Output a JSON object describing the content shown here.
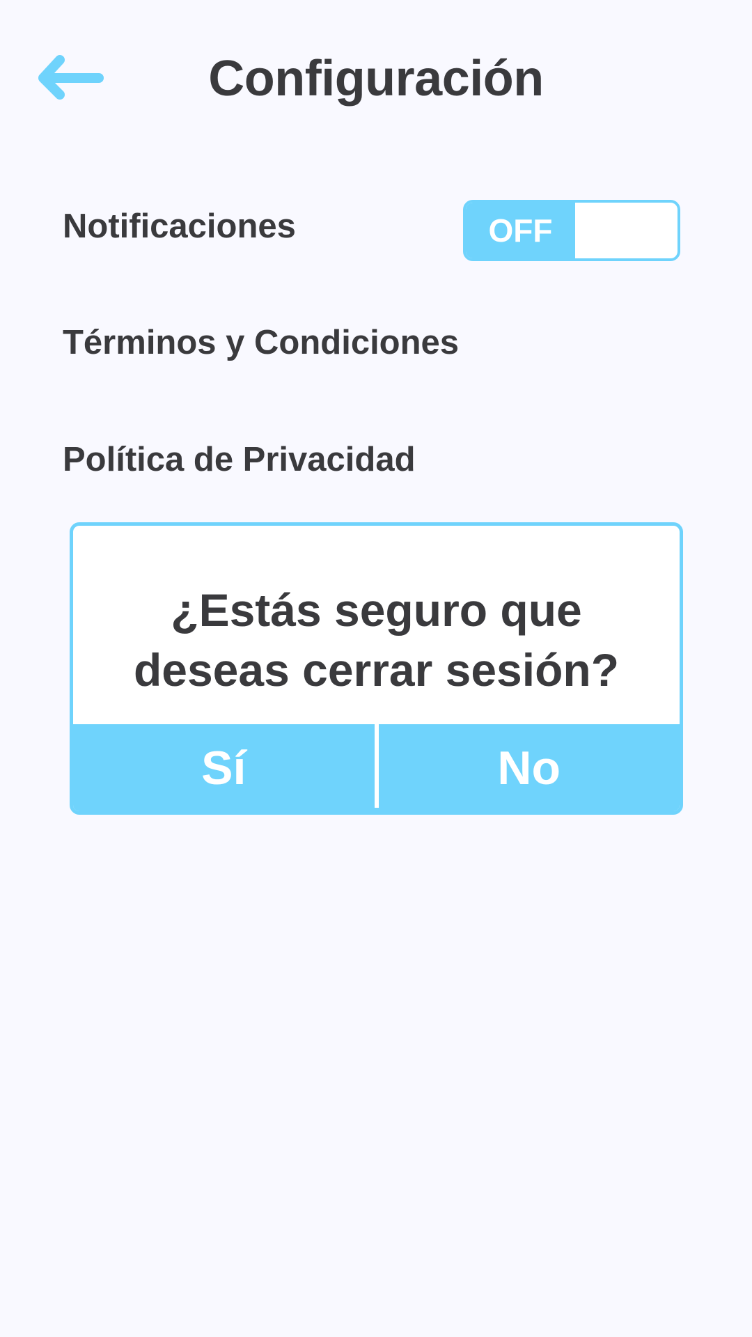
{
  "header": {
    "title": "Configuración",
    "back_icon": "arrow-left-icon"
  },
  "settings": {
    "notifications": {
      "label": "Notificaciones",
      "toggle_state": "OFF"
    },
    "terms_label": "Términos y Condiciones",
    "privacy_label": "Política de Privacidad"
  },
  "dialog": {
    "message": "¿Estás seguro que deseas cerrar sesión?",
    "yes_label": "Sí",
    "no_label": "No"
  },
  "colors": {
    "accent": "#6fd3fc",
    "background": "#f9f9ff",
    "text": "#3a3a3d"
  }
}
